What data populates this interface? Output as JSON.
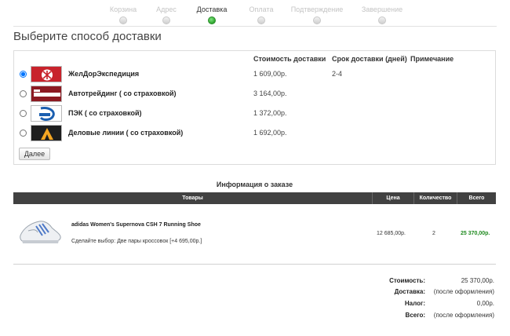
{
  "steps": [
    {
      "label": "Корзина",
      "active": false
    },
    {
      "label": "Адрес",
      "active": false
    },
    {
      "label": "Доставка",
      "active": true
    },
    {
      "label": "Оплата",
      "active": false
    },
    {
      "label": "Подтверждение",
      "active": false
    },
    {
      "label": "Завершение",
      "active": false
    }
  ],
  "page_title": "Выберите способ доставки",
  "shipping": {
    "headers": {
      "cost": "Стоимость доставки",
      "term": "Срок доставки (дней)",
      "note": "Примечание"
    },
    "options": [
      {
        "name": "ЖелДорЭкспедиция",
        "cost": "1 609,00р.",
        "term": "2-4",
        "selected": true,
        "logo": "zheldor-logo"
      },
      {
        "name": "Автотрейдинг ( со страховкой)",
        "cost": "3 164,00р.",
        "term": "",
        "selected": false,
        "logo": "avtotreiding-logo"
      },
      {
        "name": "ПЭК ( со страховкой)",
        "cost": "1 372,00р.",
        "term": "",
        "selected": false,
        "logo": "pek-logo"
      },
      {
        "name": "Деловые линии ( со страховкой)",
        "cost": "1 692,00р.",
        "term": "",
        "selected": false,
        "logo": "dellin-logo"
      }
    ],
    "next_label": "Далее"
  },
  "order": {
    "title": "Информация о заказе",
    "headers": {
      "items": "Товары",
      "price": "Цена",
      "qty": "Количество",
      "total": "Всего"
    },
    "item": {
      "name": "adidas Women's Supernova CSH 7 Running Shoe",
      "choice": "Сделайте выбор: Две пары кроссовок [+4 695,00р.]",
      "price": "12 685,00р.",
      "qty": "2",
      "total": "25 370,00р."
    }
  },
  "totals": [
    {
      "label": "Стоимость:",
      "value": "25 370,00р."
    },
    {
      "label": "Доставка:",
      "value": "(после оформления)"
    },
    {
      "label": "Налог:",
      "value": "0,00р."
    },
    {
      "label": "Всего:",
      "value": "(после оформления)"
    }
  ],
  "colors": {
    "accent_green": "#2ea52e",
    "table_header": "#414141",
    "total_green": "#1f8a1f"
  }
}
